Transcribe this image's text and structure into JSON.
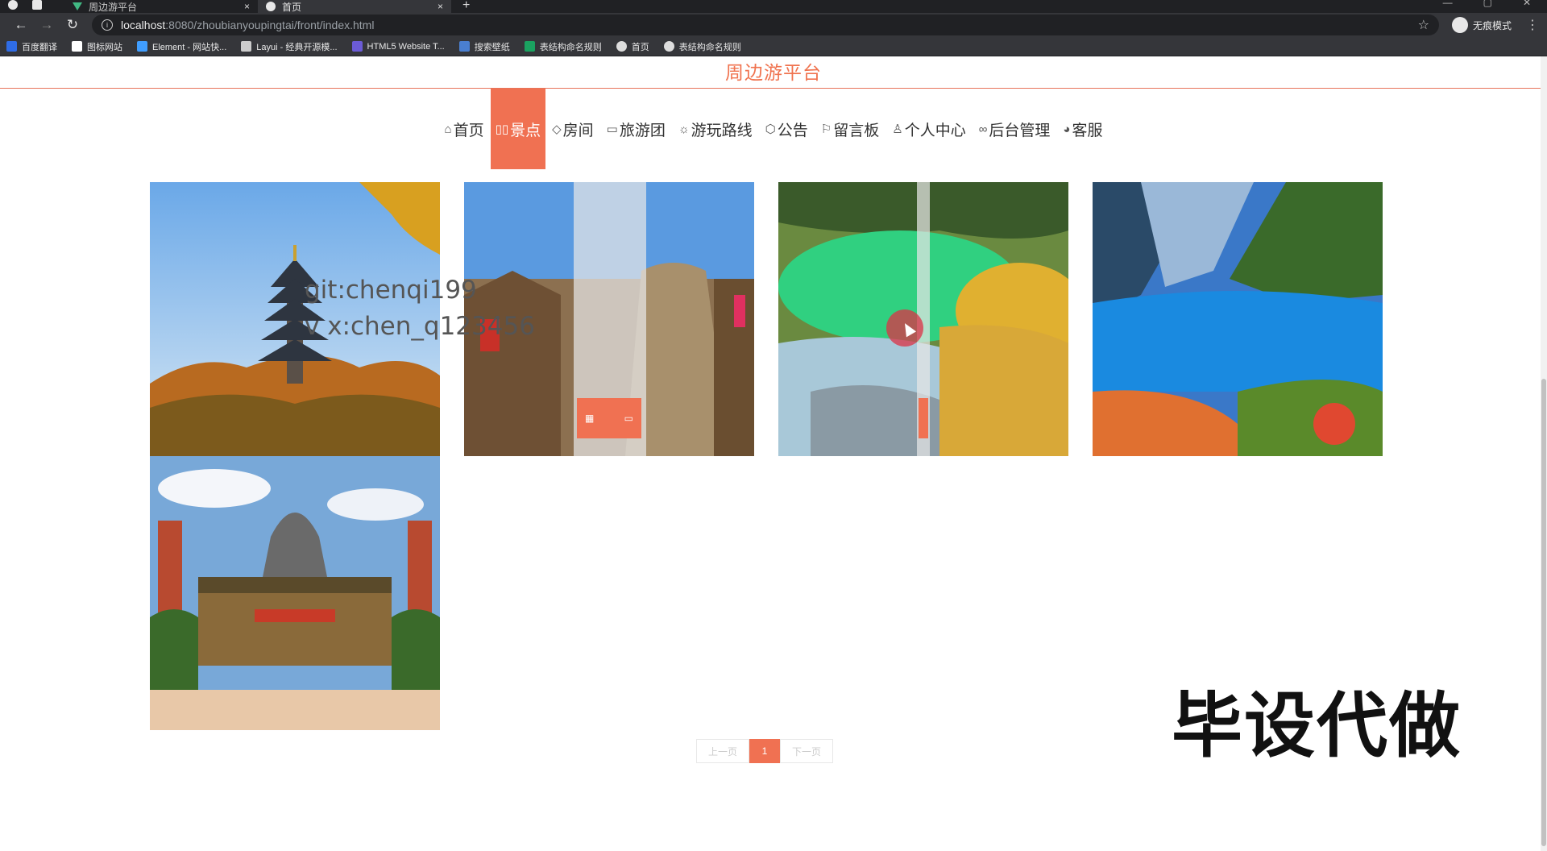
{
  "browser": {
    "tabs": [
      {
        "title": "周边游平台",
        "close": "×"
      },
      {
        "title": "首页",
        "close": "×"
      }
    ],
    "new_tab": "+",
    "url_host": "localhost",
    "url_path": ":8080/zhoubianyoupingtai/front/index.html",
    "incognito_label": "无痕模式",
    "bookmarks": [
      {
        "label": "百度翻译",
        "icon": "translate-icon",
        "color": "#2f6ce5"
      },
      {
        "label": "图标网站",
        "icon": "flag-icon",
        "color": "#ffffff"
      },
      {
        "label": "Element - 网站快...",
        "icon": "element-icon",
        "color": "#409eff"
      },
      {
        "label": "Layui - 经典开源模...",
        "icon": "layui-icon",
        "color": "#cccccc"
      },
      {
        "label": "HTML5 Website T...",
        "icon": "html5-icon",
        "color": "#6b5bd6"
      },
      {
        "label": "搜索壁纸",
        "icon": "wallpaper-icon",
        "color": "#4a7fd0"
      },
      {
        "label": "表结构命名规则",
        "icon": "sheet-icon",
        "color": "#1aa260"
      },
      {
        "label": "首页",
        "icon": "globe-icon",
        "color": "#dddddd"
      },
      {
        "label": "表结构命名规则",
        "icon": "globe-icon",
        "color": "#dddddd"
      }
    ]
  },
  "site": {
    "title": "周边游平台",
    "accent": "#f07152"
  },
  "nav": [
    {
      "label": "首页",
      "icon": "home-icon",
      "glyph": "⌂",
      "active": false
    },
    {
      "label": "景点",
      "icon": "scenic-icon",
      "glyph": "▯▯",
      "active": true
    },
    {
      "label": "房间",
      "icon": "tag-icon",
      "glyph": "◇",
      "active": false
    },
    {
      "label": "旅游团",
      "icon": "calendar-icon",
      "glyph": "▭",
      "active": false
    },
    {
      "label": "游玩路线",
      "icon": "route-icon",
      "glyph": "☼",
      "active": false
    },
    {
      "label": "公告",
      "icon": "cube-icon",
      "glyph": "⬡",
      "active": false
    },
    {
      "label": "留言板",
      "icon": "flag-icon",
      "glyph": "⚐",
      "active": false
    },
    {
      "label": "个人中心",
      "icon": "user-icon",
      "glyph": "♙",
      "active": false
    },
    {
      "label": "后台管理",
      "icon": "link-icon",
      "glyph": "∞",
      "active": false
    },
    {
      "label": "客服",
      "icon": "service-icon",
      "glyph": "◕",
      "active": false
    }
  ],
  "overlay_text": {
    "line1": "git:chenqi199",
    "line2": "v x:chen_q123456"
  },
  "stamp_text": "毕设代做",
  "pager": {
    "prev": "上一页",
    "current": "1",
    "next": "下一页"
  }
}
